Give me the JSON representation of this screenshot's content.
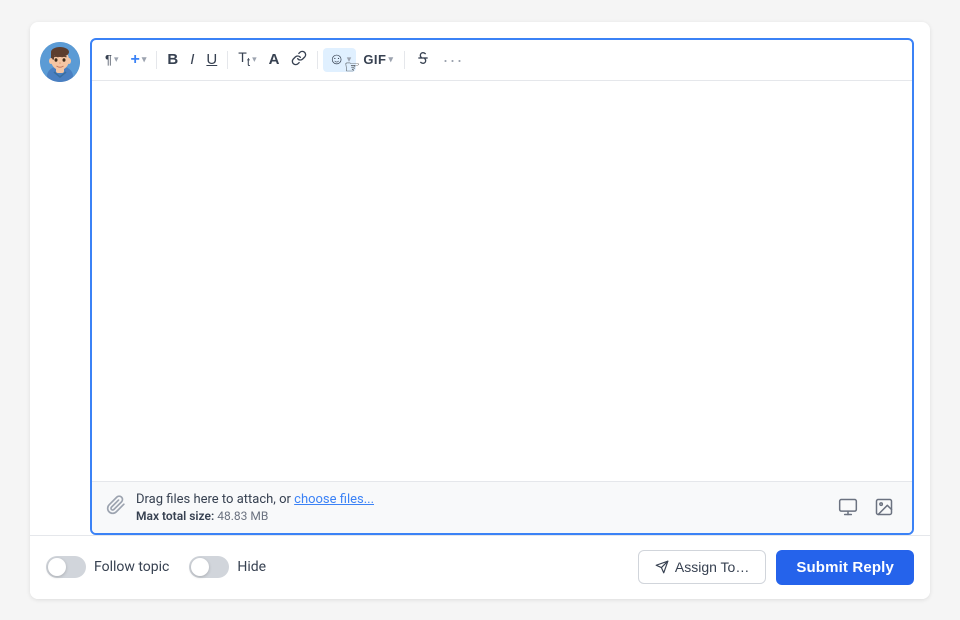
{
  "avatar": {
    "alt": "User avatar"
  },
  "toolbar": {
    "paragraph_label": "¶",
    "paragraph_chevron": "▾",
    "insert_label": "+",
    "insert_chevron": "▾",
    "bold_label": "B",
    "italic_label": "I",
    "underline_label": "U",
    "text_size_label": "Tₜ",
    "text_size_chevron": "▾",
    "text_color_label": "A",
    "link_label": "🔗",
    "emoji_label": "☺",
    "emoji_chevron": "▾",
    "gif_label": "GIF",
    "gif_chevron": "▾",
    "strikethrough_label": "—",
    "more_label": "···"
  },
  "editor": {
    "placeholder": ""
  },
  "attach": {
    "prompt_text": "Drag files here to attach, or ",
    "choose_link_text": "choose files...",
    "size_label": "Max total size:",
    "size_value": "48.83 MB"
  },
  "footer": {
    "follow_toggle_label": "Follow topic",
    "hide_toggle_label": "Hide",
    "assign_btn_label": "Assign To…",
    "submit_btn_label": "Submit Reply"
  }
}
